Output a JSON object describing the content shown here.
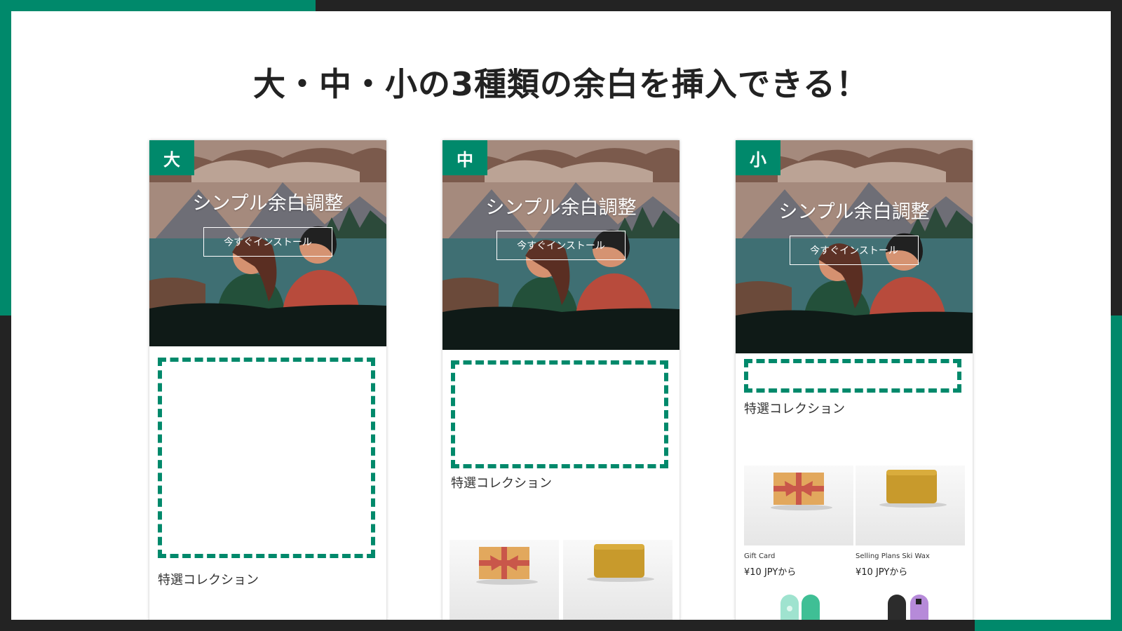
{
  "heading": "大・中・小の3種類の余白を挿入できる！",
  "colors": {
    "accent": "#00896b",
    "background": "#232323",
    "slide": "#ffffff"
  },
  "previews": [
    {
      "badge": "大",
      "hero_title": "シンプル余白調整",
      "hero_button": "今すぐインストール",
      "section_title": "特選コレクション",
      "products": []
    },
    {
      "badge": "中",
      "hero_title": "シンプル余白調整",
      "hero_button": "今すぐインストール",
      "section_title": "特選コレクション",
      "products": []
    },
    {
      "badge": "小",
      "hero_title": "シンプル余白調整",
      "hero_button": "今すぐインストール",
      "section_title": "特選コレクション",
      "products": [
        {
          "name": "Gift Card",
          "price": "¥10 JPYから"
        },
        {
          "name": "Selling Plans Ski Wax",
          "price": "¥10 JPYから"
        }
      ]
    }
  ]
}
